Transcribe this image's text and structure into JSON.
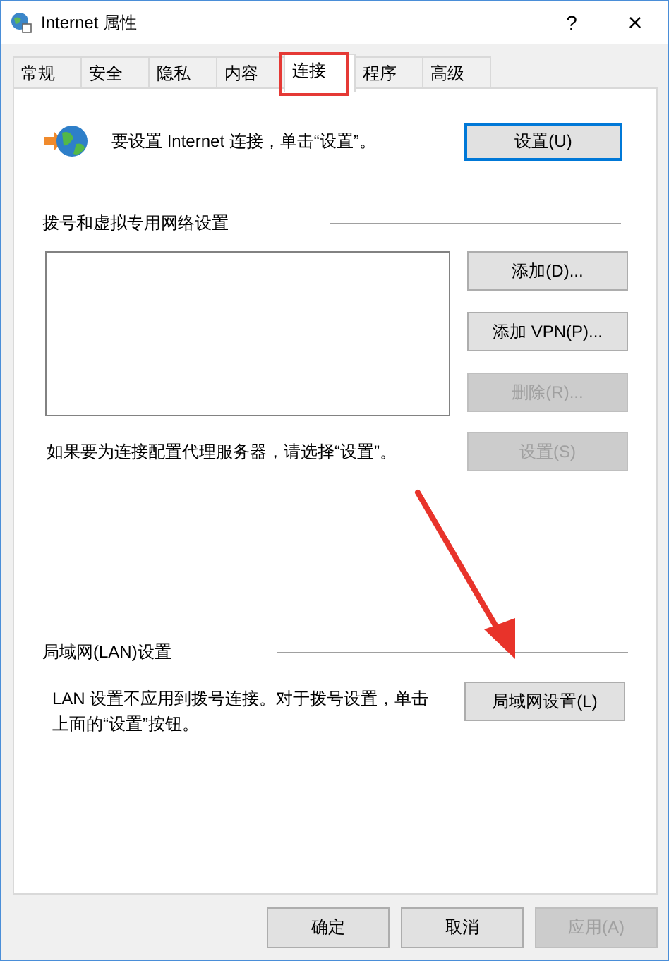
{
  "window": {
    "title": "Internet 属性",
    "help": "?",
    "close": "×"
  },
  "tabs": [
    {
      "label": "常规",
      "selected": false,
      "annotated": false
    },
    {
      "label": "安全",
      "selected": false,
      "annotated": false
    },
    {
      "label": "隐私",
      "selected": false,
      "annotated": false
    },
    {
      "label": "内容",
      "selected": false,
      "annotated": false
    },
    {
      "label": "连接",
      "selected": true,
      "annotated": true
    },
    {
      "label": "程序",
      "selected": false,
      "annotated": false
    },
    {
      "label": "高级",
      "selected": false,
      "annotated": false
    }
  ],
  "setup": {
    "text": "要设置 Internet 连接，单击“设置”。",
    "button": {
      "label": "设置(U)",
      "default": true
    }
  },
  "dialup": {
    "heading": "拨号和虚拟专用网络设置",
    "buttons": [
      {
        "label": "添加(D)...",
        "disabled": false
      },
      {
        "label": "添加 VPN(P)...",
        "disabled": false
      },
      {
        "label": "删除(R)...",
        "disabled": true
      }
    ],
    "proxy_text": "如果要为连接配置代理服务器，请选择“设置”。",
    "proxy_button": {
      "label": "设置(S)",
      "disabled": true
    }
  },
  "lan": {
    "heading": "局域网(LAN)设置",
    "text": "LAN 设置不应用到拨号连接。对于拨号设置，单击上面的“设置”按钮。",
    "button": {
      "label": "局域网设置(L)",
      "annotated": true
    }
  },
  "footer_buttons": [
    {
      "label": "确定",
      "disabled": false
    },
    {
      "label": "取消",
      "disabled": false
    },
    {
      "label": "应用(A)",
      "disabled": true
    }
  ]
}
